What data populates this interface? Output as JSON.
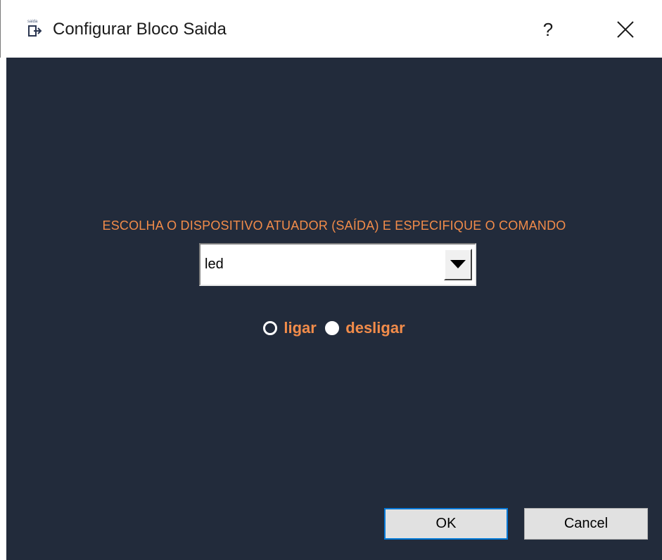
{
  "window": {
    "title": "Configurar Bloco Saida",
    "help_label": "?",
    "icon_caption": "saida"
  },
  "dialog": {
    "prompt": "ESCOLHA O DISPOSITIVO ATUADOR (SAÍDA) E ESPECIFIQUE O COMANDO",
    "device_select": {
      "value": "led"
    },
    "command_options": [
      {
        "label": "ligar",
        "selected": false
      },
      {
        "label": "desligar",
        "selected": true
      }
    ]
  },
  "buttons": {
    "ok": "OK",
    "cancel": "Cancel"
  },
  "colors": {
    "background": "#222b3b",
    "accent": "#f28c4a",
    "focus": "#0078d7"
  },
  "icons": [
    "output-block-icon",
    "close-icon",
    "dropdown-arrow-icon"
  ]
}
